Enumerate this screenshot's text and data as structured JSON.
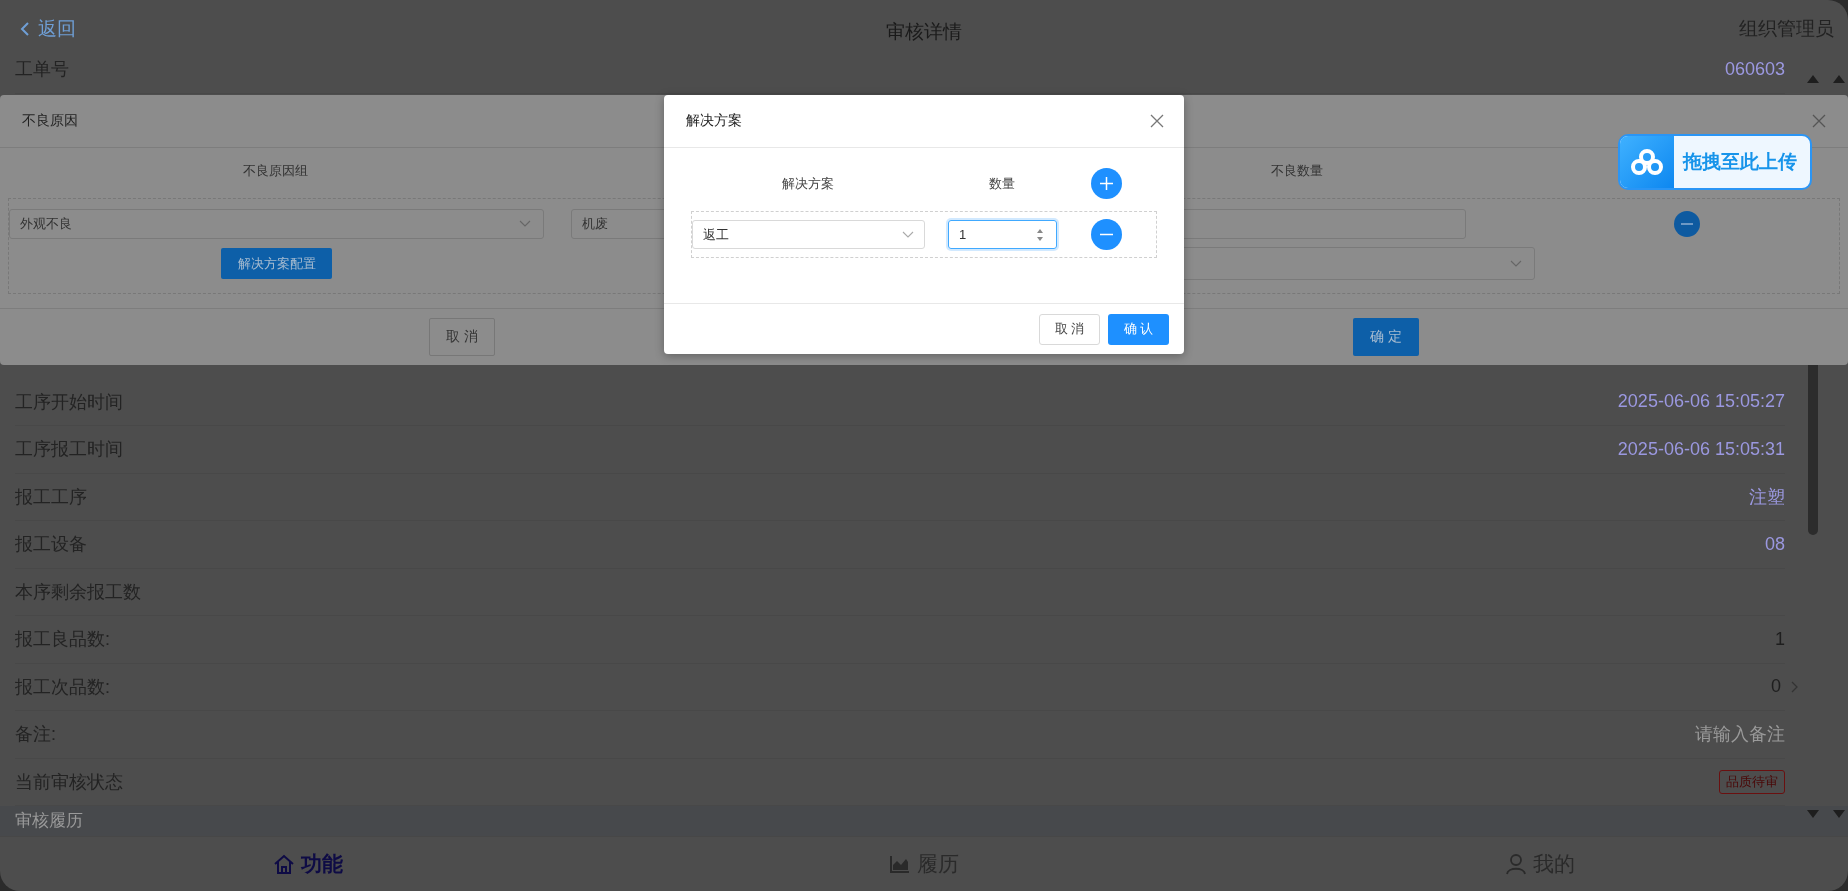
{
  "header": {
    "back": "返回",
    "title": "审核详情",
    "user": "组织管理员"
  },
  "top_rows": [
    {
      "label": "工单号",
      "value": "060603",
      "kind": "info"
    }
  ],
  "rows": [
    {
      "label": "工序开始时间",
      "value": "2025-06-06 15:05:27",
      "kind": "info"
    },
    {
      "label": "工序报工时间",
      "value": "2025-06-06 15:05:31",
      "kind": "info"
    },
    {
      "label": "报工工序",
      "value": "注塑",
      "kind": "info"
    },
    {
      "label": "报工设备",
      "value": "08",
      "kind": "info"
    },
    {
      "label": "本序剩余报工数",
      "kind": "info"
    },
    {
      "label": "报工良品数:",
      "value": "1",
      "kind": "count"
    },
    {
      "label": "报工次品数:",
      "value": "0",
      "kind": "link"
    },
    {
      "label": "备注:",
      "placeholder": "请输入备注",
      "kind": "input"
    },
    {
      "label": "当前审核状态",
      "value": "品质待审",
      "kind": "tag"
    }
  ],
  "section_title": "审核履历",
  "tab_bar": [
    {
      "label": "功能",
      "selected": true
    },
    {
      "label": "履历",
      "selected": false
    },
    {
      "label": "我的",
      "selected": false
    }
  ],
  "defect_dialog": {
    "title": "不良原因",
    "columns": [
      "不良原因组",
      "不良数量"
    ],
    "row": {
      "group": "外观不良",
      "reason": "机废",
      "config_button": "解决方案配置"
    },
    "buttons": [
      "取 消",
      "确 定"
    ]
  },
  "solution_dialog": {
    "title": "解决方案",
    "columns": [
      "解决方案",
      "数量"
    ],
    "rows": [
      {
        "solution": "返工",
        "quantity": "1"
      }
    ],
    "buttons": [
      "取 消",
      "确 认"
    ]
  },
  "upload_widget": {
    "label": "拖拽至此上传"
  }
}
